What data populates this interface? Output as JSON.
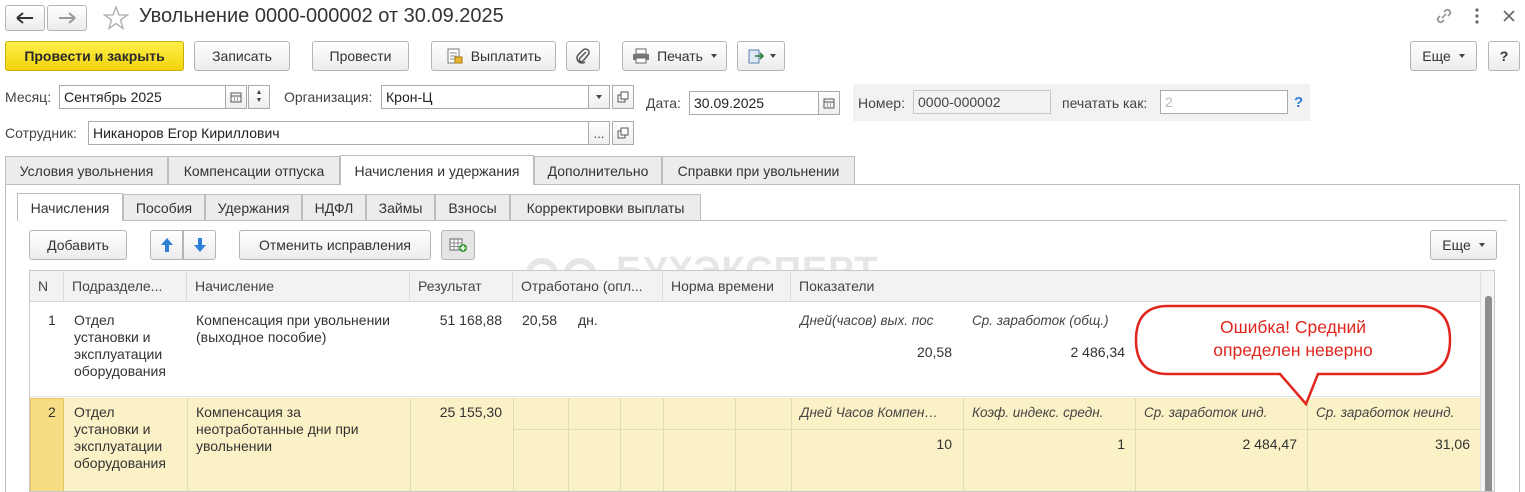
{
  "window": {
    "title": "Увольнение 0000-000002 от 30.09.2025"
  },
  "toolbar": {
    "post_close": "Провести и закрыть",
    "save": "Записать",
    "post": "Провести",
    "pay": "Выплатить",
    "print": "Печать",
    "more": "Еще",
    "help": "?"
  },
  "form": {
    "month_label": "Месяц:",
    "month_value": "Сентябрь 2025",
    "org_label": "Организация:",
    "org_value": "Крон-Ц",
    "date_label": "Дата:",
    "date_value": "30.09.2025",
    "number_label": "Номер:",
    "number_value": "0000-000002",
    "print_as_label": "печатать как:",
    "print_as_placeholder": "2",
    "help_q": "?",
    "employee_label": "Сотрудник:",
    "employee_value": "Никаноров Егор Кириллович",
    "ellipsis": "..."
  },
  "tabs": [
    {
      "label": "Условия увольнения"
    },
    {
      "label": "Компенсации отпуска"
    },
    {
      "label": "Начисления и удержания"
    },
    {
      "label": "Дополнительно"
    },
    {
      "label": "Справки при увольнении"
    }
  ],
  "subtabs": [
    {
      "label": "Начисления"
    },
    {
      "label": "Пособия"
    },
    {
      "label": "Удержания"
    },
    {
      "label": "НДФЛ"
    },
    {
      "label": "Займы"
    },
    {
      "label": "Взносы"
    },
    {
      "label": "Корректировки выплаты"
    }
  ],
  "table_toolbar": {
    "add": "Добавить",
    "cancel_corrections": "Отменить исправления",
    "more": "Еще"
  },
  "watermark": "БУХЭКСПЕРТ",
  "table": {
    "headers": [
      "N",
      "Подразделе...",
      "Начисление",
      "Результат",
      "Отработано (опл...",
      "Норма времени",
      "Показатели"
    ],
    "rows": [
      {
        "n": "1",
        "dept": [
          "Отдел",
          "установки и",
          "эксплуатации",
          "оборудования"
        ],
        "accrual": [
          "Компенсация при увольнении",
          "(выходное пособие)"
        ],
        "result": "51 168,88",
        "worked": "20,58",
        "worked_unit": "дн.",
        "ind1_label": "Дней(часов) вых. пос",
        "ind1_value": "20,58",
        "ind2_label": "Ср. заработок (общ.)",
        "ind2_value": "2 486,34"
      },
      {
        "n": "2",
        "dept": [
          "Отдел",
          "установки и",
          "эксплуатации",
          "оборудования"
        ],
        "accrual": [
          "Компенсация за",
          "неотработанные дни при",
          "увольнении"
        ],
        "result": "25 155,30",
        "ind1_label": "Дней Часов Компен…",
        "ind1_value": "10",
        "ind2_label": "Коэф. индекс. средн.",
        "ind2_value": "1",
        "ind3_label": "Ср. заработок инд.",
        "ind3_value": "2 484,47",
        "ind4_label": "Ср. заработок неинд.",
        "ind4_value": "31,06"
      }
    ]
  },
  "callout": {
    "line1": "Ошибка! Средний",
    "line2": "определен неверно",
    "color": "#e0261d"
  },
  "colors": {
    "primary_button": "#f7dd1b",
    "selected_row": "#fbf1c6",
    "arrow_blue": "#2e7fd6"
  }
}
